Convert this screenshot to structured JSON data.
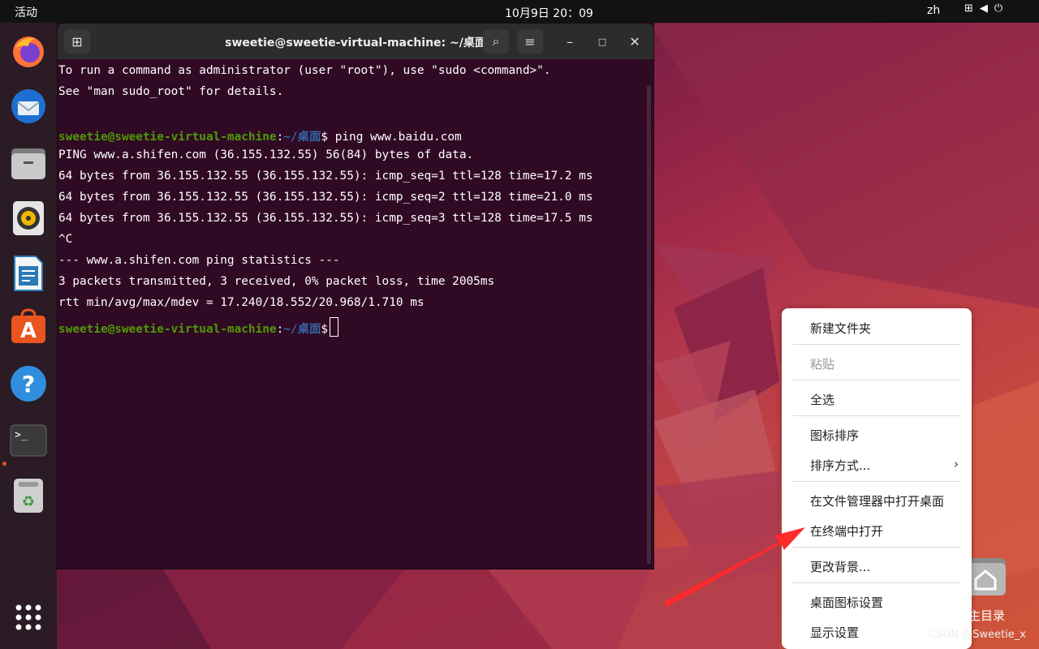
{
  "topbar": {
    "activities": "活动",
    "clock": "10月9日  20：09",
    "input_method": "zh"
  },
  "dock": {
    "apps": [
      "firefox",
      "thunderbird",
      "files",
      "rhythmbox",
      "libreoffice-writer",
      "app-center",
      "help",
      "terminal",
      "trash",
      "show-apps"
    ]
  },
  "terminal": {
    "title": "sweetie@sweetie-virtual-machine: ~/桌面",
    "lines": [
      "To run a command as administrator (user \"root\"), use \"sudo <command>\".",
      "See \"man sudo_root\" for details.",
      "",
      "",
      "PING www.a.shifen.com (36.155.132.55) 56(84) bytes of data.",
      "64 bytes from 36.155.132.55 (36.155.132.55): icmp_seq=1 ttl=128 time=17.2 ms",
      "64 bytes from 36.155.132.55 (36.155.132.55): icmp_seq=2 ttl=128 time=21.0 ms",
      "64 bytes from 36.155.132.55 (36.155.132.55): icmp_seq=3 ttl=128 time=17.5 ms",
      "^C",
      "--- www.a.shifen.com ping statistics ---",
      "3 packets transmitted, 3 received, 0% packet loss, time 2005ms",
      "rtt min/avg/max/mdev = 17.240/18.552/20.968/1.710 ms"
    ],
    "prompt_user": "sweetie@sweetie-virtual-machine",
    "prompt_sep": ":",
    "prompt_dir": "~/桌面",
    "prompt_sym": "$",
    "command1": " ping www.baidu.com"
  },
  "context_menu": {
    "items": [
      "新建文件夹",
      "粘贴",
      "全选",
      "图标排序",
      "排序方式...",
      "在文件管理器中打开桌面",
      "在终端中打开",
      "更改背景...",
      "桌面图标设置",
      "显示设置"
    ]
  },
  "desktop": {
    "home_label": "主目录"
  },
  "watermark": "CSDN @Sweetie_x",
  "colors": {
    "terminal_bg": "#300a24",
    "prompt_green": "#4e9a06",
    "prompt_blue": "#3465a4",
    "accent": "#e95420",
    "arrow": "#ff2a2a"
  }
}
